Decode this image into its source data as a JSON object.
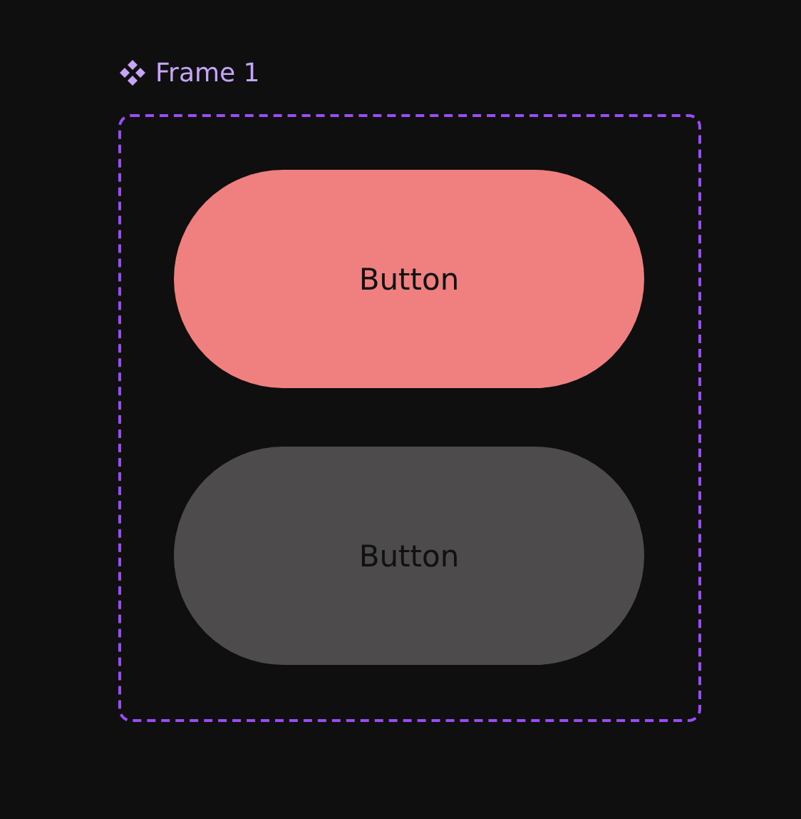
{
  "frame": {
    "title": "Frame 1"
  },
  "buttons": [
    {
      "label": "Button",
      "color": "#f08080"
    },
    {
      "label": "Button",
      "color": "#4d4b4b"
    }
  ]
}
